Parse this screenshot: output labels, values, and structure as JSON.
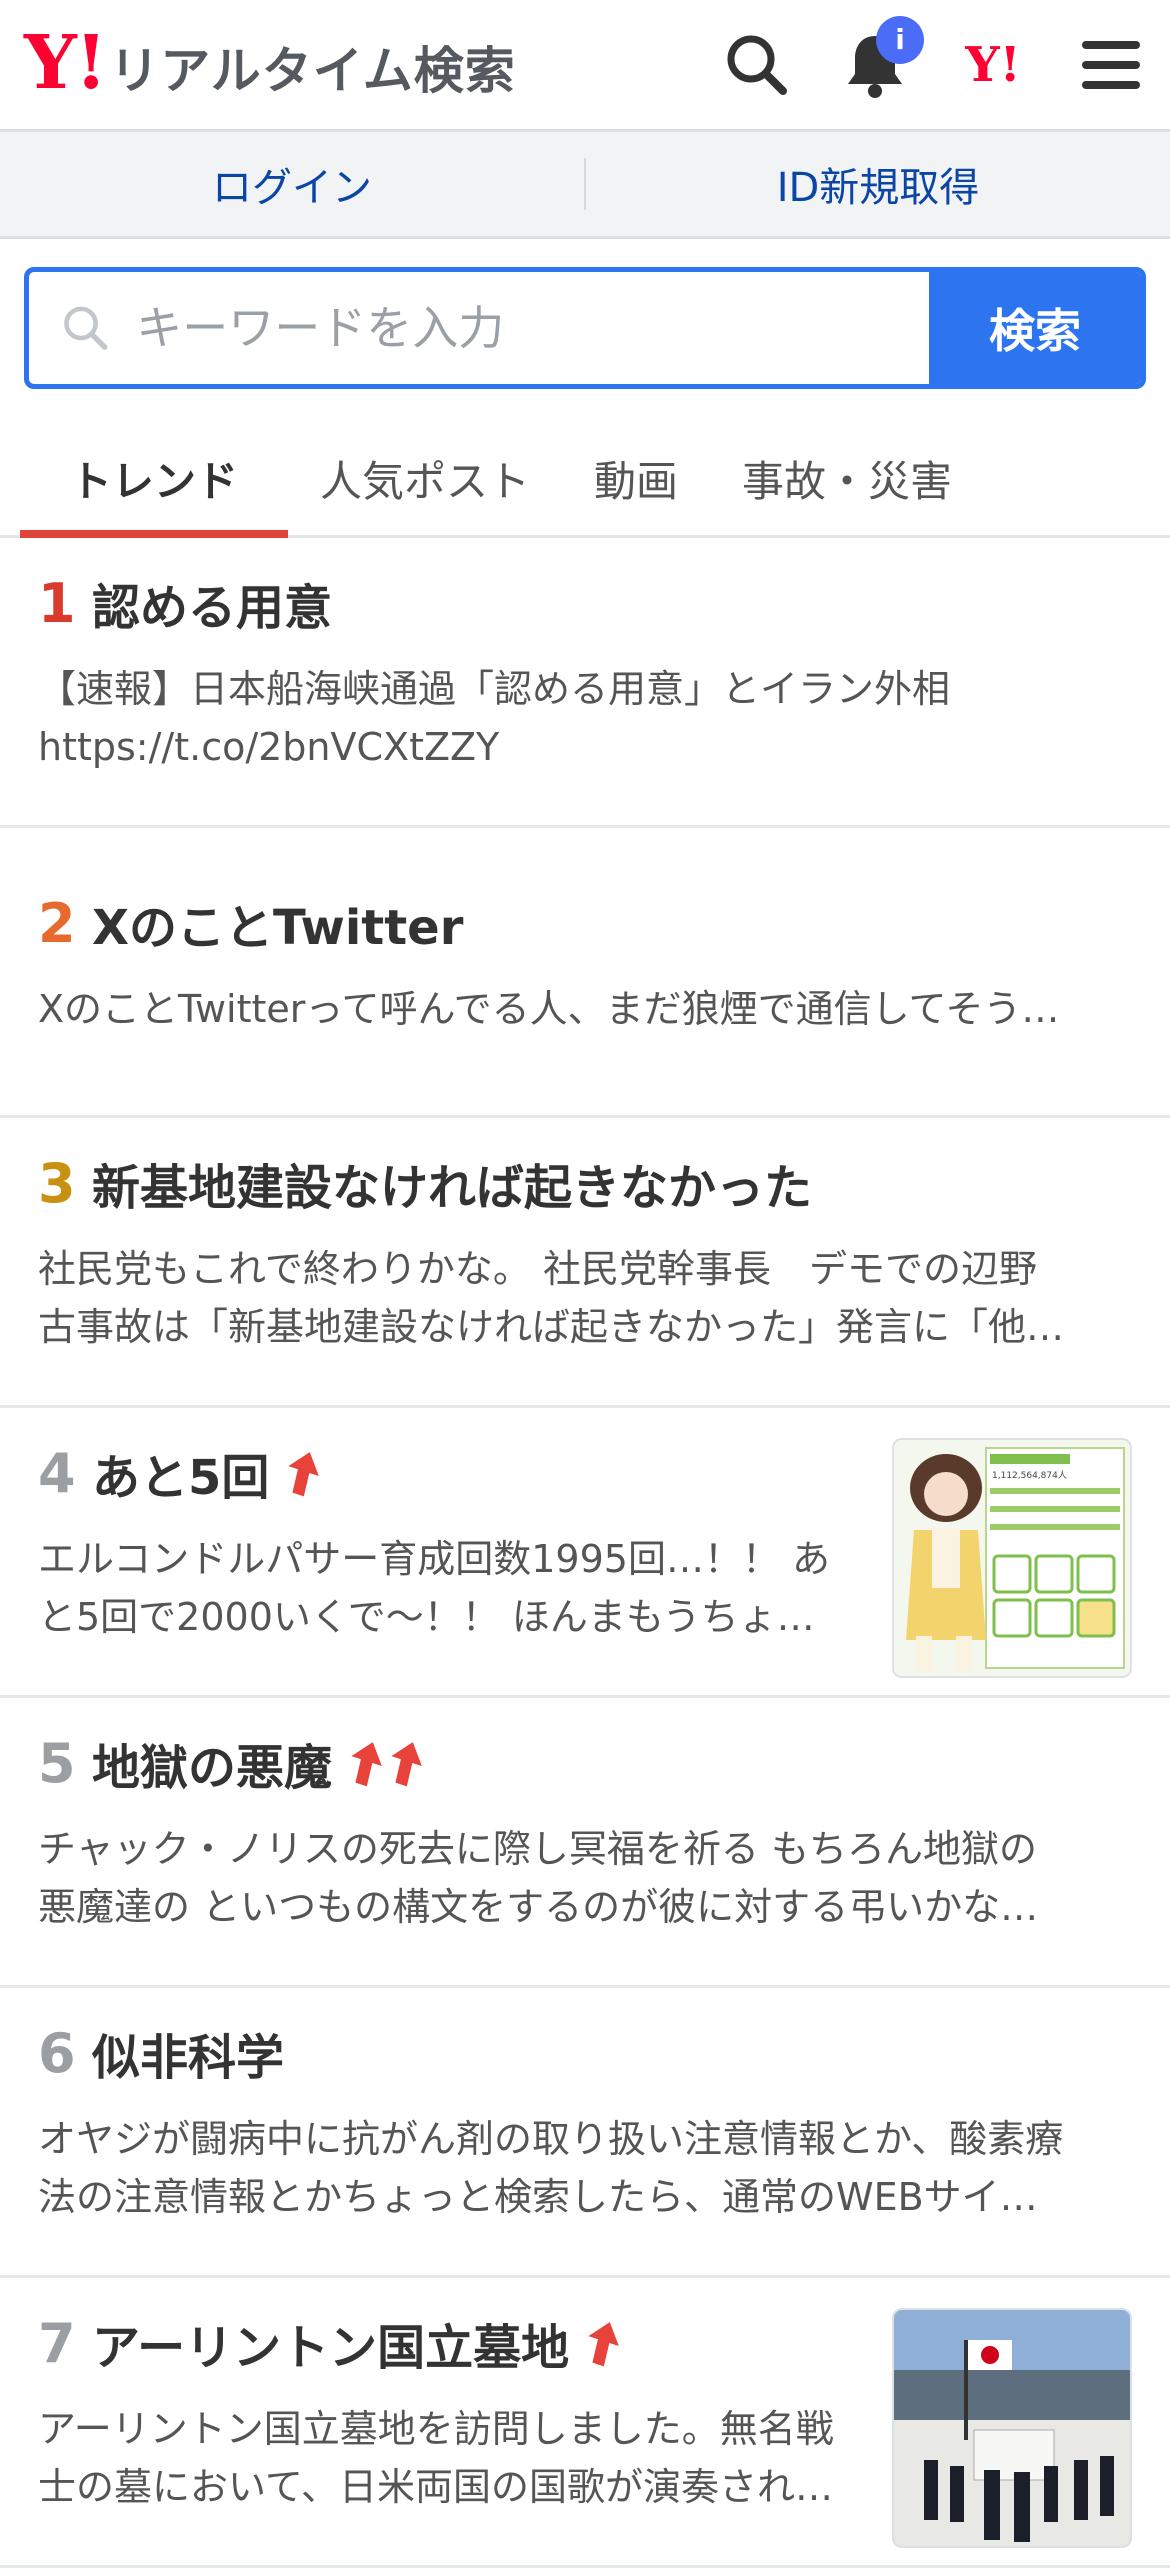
{
  "header": {
    "logo_mark": "Y!",
    "title": "リアルタイム検索",
    "badge": "i",
    "yahoo_mark": "Y!"
  },
  "login_bar": {
    "login": "ログイン",
    "signup": "ID新規取得"
  },
  "search": {
    "placeholder": "キーワードを入力",
    "button": "検索"
  },
  "tabs": [
    {
      "label": "トレンド",
      "active": true
    },
    {
      "label": "人気ポスト"
    },
    {
      "label": "動画"
    },
    {
      "label": "事故・災害"
    }
  ],
  "colors": {
    "brand": "#ff0033",
    "accent": "#2d74f0",
    "rank1": "#d93a2b",
    "rank2": "#e56a2c",
    "rank3": "#c89112",
    "rank_other": "#9b9ea3",
    "arrow": "#e8433a"
  },
  "trends": [
    {
      "rank": "1",
      "title": "認める用意",
      "desc_line1": "【速報】日本船海峡通過「認める用意」とイラン外相",
      "desc_line2": "https://t.co/2bnVCXtZZY"
    },
    {
      "rank": "2",
      "title": "XのことTwitter",
      "desc_line1": "XのことTwitterって呼んでる人、まだ狼煙で通信してそう…"
    },
    {
      "rank": "3",
      "title": "新基地建設なければ起きなかった",
      "desc_line1": "社民党もこれで終わりかな。 社民党幹事長　デモでの辺野",
      "desc_line2": "古事故は「新基地建設なければ起きなかった」発言に「他…"
    },
    {
      "rank": "4",
      "title": "あと5回",
      "desc_line1": "エルコンドルパサー育成回数1995回…！！ あ",
      "desc_line2": "と5回で2000いくで〜！！ ほんまもうちょ…",
      "thumb_card": "1,112,564,874人"
    },
    {
      "rank": "5",
      "title": "地獄の悪魔",
      "desc_line1": "チャック・ノリスの死去に際し冥福を祈る もちろん地獄の",
      "desc_line2": "悪魔達の といつもの構文をするのが彼に対する弔いかな…"
    },
    {
      "rank": "6",
      "title": "似非科学",
      "desc_line1": "オヤジが闘病中に抗がん剤の取り扱い注意情報とか、酸素療",
      "desc_line2": "法の注意情報とかちょっと検索したら、通常のWEBサイ…"
    },
    {
      "rank": "7",
      "title": "アーリントン国立墓地",
      "desc_line1": "アーリントン国立墓地を訪問しました。無名戦",
      "desc_line2": "士の墓において、日米両国の国歌が演奏され…"
    }
  ]
}
